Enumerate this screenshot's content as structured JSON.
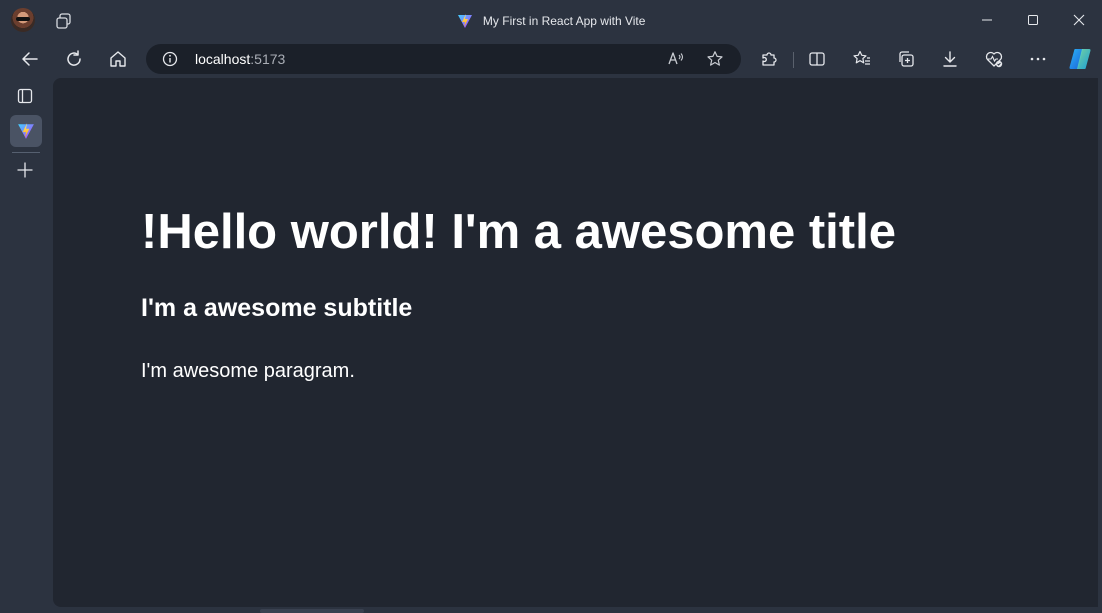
{
  "window": {
    "title": "My First in React App with Vite"
  },
  "toolbar": {
    "url_host": "localhost",
    "url_port": ":5173"
  },
  "page": {
    "title": "!Hello world! I'm a awesome title",
    "subtitle": "I'm a awesome subtitle",
    "paragraph": "I'm awesome paragram."
  },
  "icons": {
    "back": "back-arrow-icon",
    "refresh": "refresh-icon",
    "home": "home-icon",
    "info": "info-icon",
    "read_aloud": "read-aloud-icon",
    "favorite": "star-icon",
    "extensions": "puzzle-icon",
    "split": "split-screen-icon",
    "favorites": "favorites-icon",
    "collections": "collections-icon",
    "downloads": "download-icon",
    "browser_essentials": "heart-pulse-icon",
    "more": "more-icon",
    "copilot": "copilot-icon"
  },
  "colors": {
    "frame": "#2c3340",
    "viewport": "#212630",
    "addressbar": "#1b2029",
    "text": "#ffffff"
  }
}
